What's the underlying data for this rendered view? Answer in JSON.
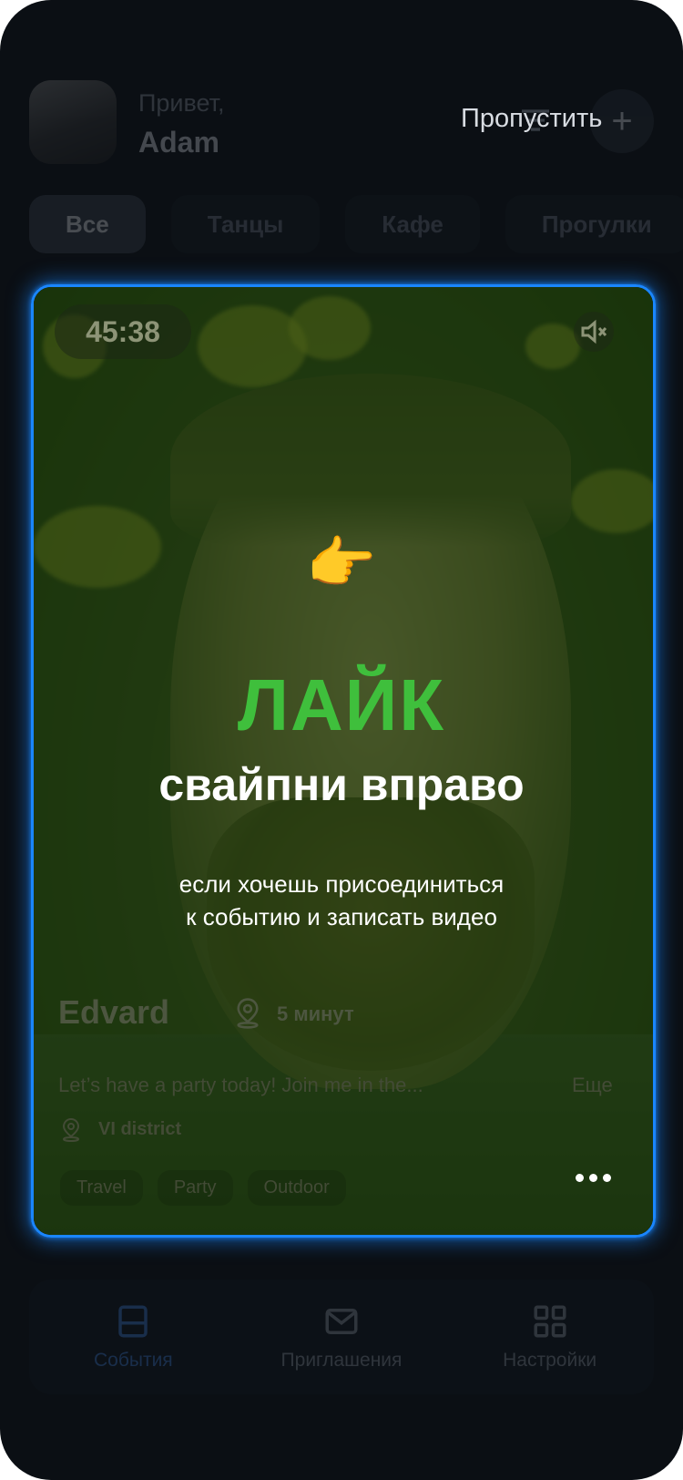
{
  "header": {
    "greeting": "Привет,",
    "user_name": "Adam",
    "skip_label": "Пропустить",
    "add_label": "+"
  },
  "tabs": [
    {
      "label": "Все"
    },
    {
      "label": "Танцы"
    },
    {
      "label": "Кафе"
    },
    {
      "label": "Прогулки"
    }
  ],
  "card": {
    "timer": "45:38",
    "name": "Edvard",
    "time": "5 минут",
    "description": "Let’s have a party today! Join me in the...",
    "more_label": "Еще",
    "location": "VI district",
    "tags": [
      "Travel",
      "Party",
      "Outdoor"
    ]
  },
  "onboarding": {
    "emoji": "👉",
    "title": "ЛАЙК",
    "subtitle": "свайпни вправо",
    "description_line1": "если хочешь присоединиться",
    "description_line2": "к событию и записать видео"
  },
  "bottom_nav": [
    {
      "label": "События"
    },
    {
      "label": "Приглашения"
    },
    {
      "label": "Настройки"
    }
  ],
  "colors": {
    "accent_blue": "#1a86ff",
    "like_green": "#3fbf3c",
    "background": "#0b0f14"
  }
}
